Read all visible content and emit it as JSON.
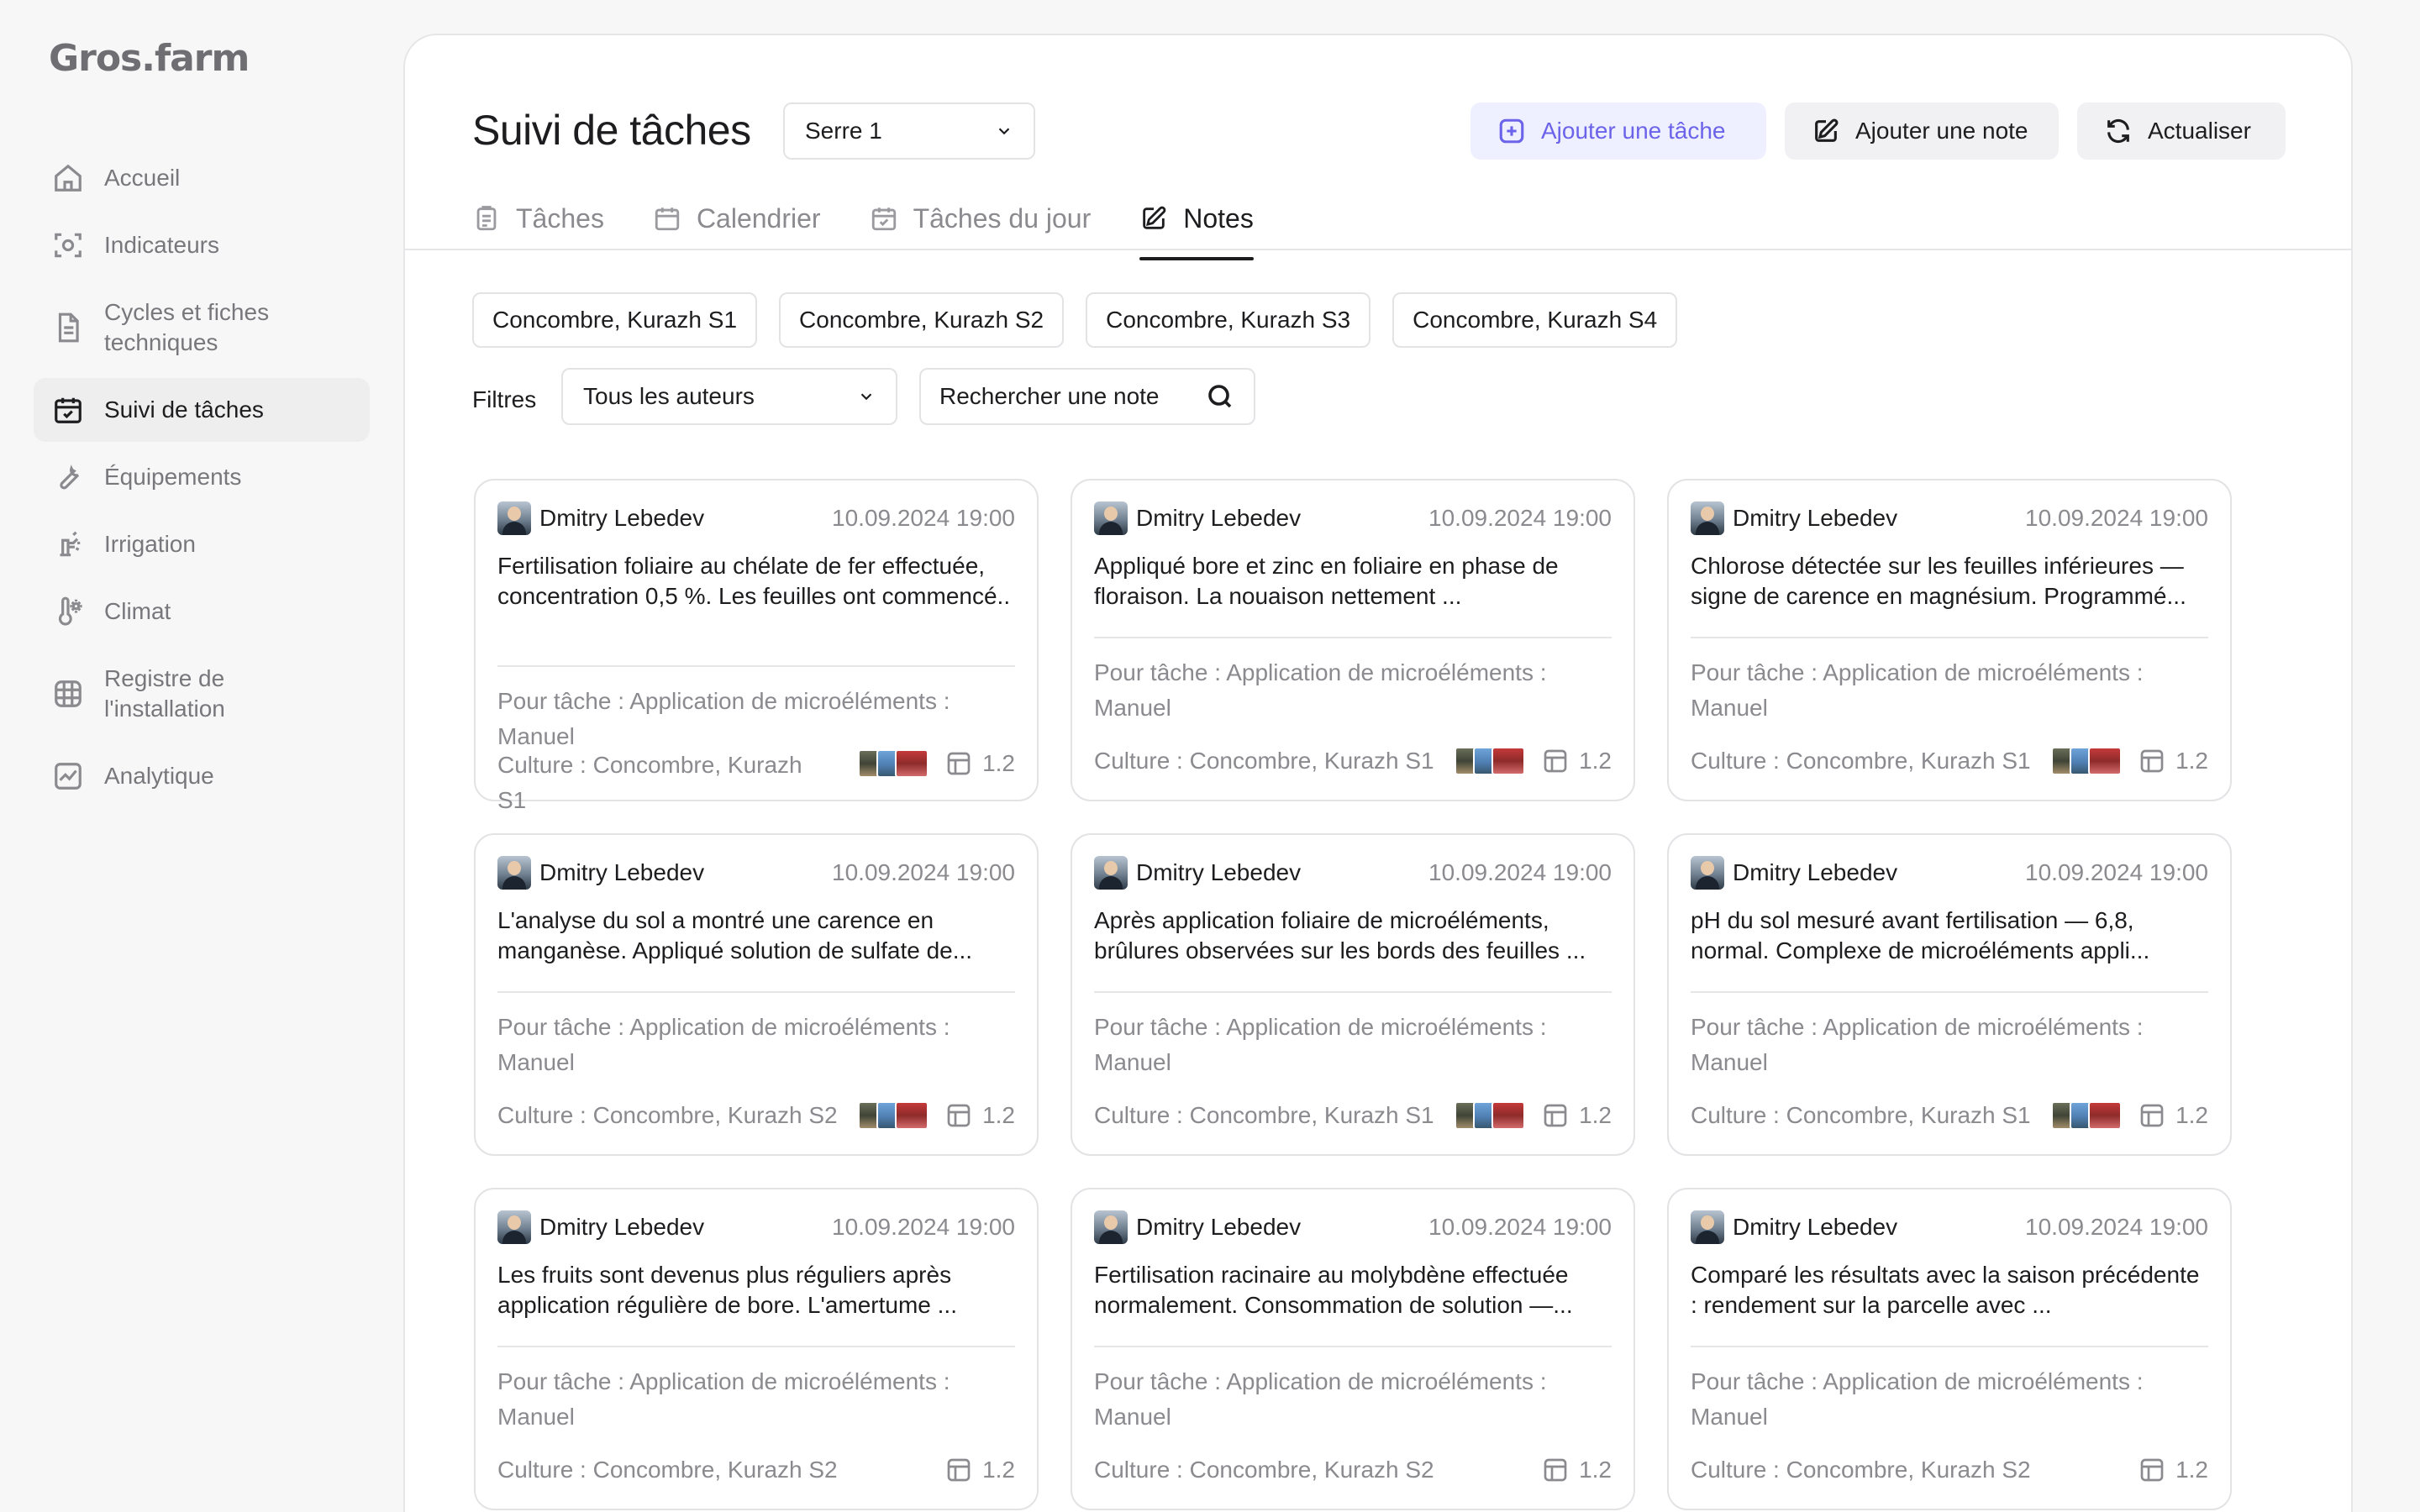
{
  "app": {
    "logo": "Gros.farm"
  },
  "sidebar": {
    "items": [
      {
        "label": "Accueil",
        "icon": "home-icon",
        "active": false
      },
      {
        "label": "Indicateurs",
        "icon": "sensor-icon",
        "active": false
      },
      {
        "label": "Cycles et fiches techniques",
        "icon": "document-icon",
        "active": false
      },
      {
        "label": "Suivi de tâches",
        "icon": "calendar-check-icon",
        "active": true
      },
      {
        "label": "Équipements",
        "icon": "wrench-icon",
        "active": false
      },
      {
        "label": "Irrigation",
        "icon": "sprinkler-icon",
        "active": false
      },
      {
        "label": "Climat",
        "icon": "thermometer-sun-icon",
        "active": false
      },
      {
        "label": "Registre de l'installation",
        "icon": "grid-icon",
        "active": false
      },
      {
        "label": "Analytique",
        "icon": "chart-icon",
        "active": false
      }
    ]
  },
  "header": {
    "title": "Suivi de tâches",
    "greenhouse_select": "Serre 1",
    "buttons": {
      "add_task": "Ajouter une tâche",
      "add_note": "Ajouter une note",
      "refresh": "Actualiser"
    }
  },
  "tabs": [
    {
      "label": "Tâches",
      "icon": "clipboard-icon",
      "active": false
    },
    {
      "label": "Calendrier",
      "icon": "calendar-icon",
      "active": false
    },
    {
      "label": "Tâches du jour",
      "icon": "calendar-day-icon",
      "active": false
    },
    {
      "label": "Notes",
      "icon": "edit-note-icon",
      "active": true
    }
  ],
  "chips": [
    "Concombre, Kurazh S1",
    "Concombre, Kurazh S2",
    "Concombre, Kurazh S3",
    "Concombre, Kurazh S4"
  ],
  "filters": {
    "label": "Filtres",
    "author_select": "Tous les auteurs",
    "search_placeholder": "Rechercher une note"
  },
  "notes": [
    {
      "author": "Dmitry Lebedev",
      "date": "10.09.2024 19:00",
      "text": "Fertilisation foliaire au chélate de fer effectuée, concentration 0,5 %. Les feuilles ont commencé..",
      "task": "Pour tâche : Application de microéléments : Manuel",
      "culture": "Culture : Concombre, Kurazh S1",
      "version": "1.2",
      "photos": true
    },
    {
      "author": "Dmitry Lebedev",
      "date": "10.09.2024 19:00",
      "text": "Appliqué bore et zinc en foliaire en phase de floraison. La nouaison nettement ...",
      "task": "Pour tâche : Application de microéléments : Manuel",
      "culture": "Culture : Concombre, Kurazh S1",
      "version": "1.2",
      "photos": true
    },
    {
      "author": "Dmitry Lebedev",
      "date": "10.09.2024 19:00",
      "text": "Chlorose détectée sur les feuilles inférieures — signe de carence en magnésium. Programmé...",
      "task": "Pour tâche : Application de microéléments : Manuel",
      "culture": "Culture : Concombre, Kurazh S1",
      "version": "1.2",
      "photos": true
    },
    {
      "author": "Dmitry Lebedev",
      "date": "10.09.2024 19:00",
      "text": "L'analyse du sol a montré une carence en manganèse. Appliqué solution de sulfate de...",
      "task": "Pour tâche : Application de microéléments : Manuel",
      "culture": "Culture : Concombre, Kurazh S2",
      "version": "1.2",
      "photos": true
    },
    {
      "author": "Dmitry Lebedev",
      "date": "10.09.2024 19:00",
      "text": "Après application foliaire de microéléments, brûlures observées sur les bords des feuilles ...",
      "task": "Pour tâche : Application de microéléments : Manuel",
      "culture": "Culture : Concombre, Kurazh S1",
      "version": "1.2",
      "photos": true
    },
    {
      "author": "Dmitry Lebedev",
      "date": "10.09.2024 19:00",
      "text": "pH du sol mesuré avant fertilisation — 6,8, normal. Complexe de microéléments appli...",
      "task": "Pour tâche : Application de microéléments : Manuel",
      "culture": "Culture : Concombre, Kurazh S1",
      "version": "1.2",
      "photos": true
    },
    {
      "author": "Dmitry Lebedev",
      "date": "10.09.2024 19:00",
      "text": "Les fruits sont devenus plus réguliers après application régulière de bore. L'amertume ...",
      "task": "Pour tâche : Application de microéléments : Manuel",
      "culture": "Culture : Concombre, Kurazh S2",
      "version": "1.2",
      "photos": false
    },
    {
      "author": "Dmitry Lebedev",
      "date": "10.09.2024 19:00",
      "text": "Fertilisation racinaire au molybdène effectuée normalement. Consommation de solution —...",
      "task": "Pour tâche : Application de microéléments : Manuel",
      "culture": "Culture : Concombre, Kurazh S2",
      "version": "1.2",
      "photos": false
    },
    {
      "author": "Dmitry Lebedev",
      "date": "10.09.2024 19:00",
      "text": "Comparé les résultats avec la saison précédente : rendement sur la parcelle avec ...",
      "task": "Pour tâche : Application de microéléments : Manuel",
      "culture": "Culture : Concombre, Kurazh S2",
      "version": "1.2",
      "photos": false
    }
  ]
}
